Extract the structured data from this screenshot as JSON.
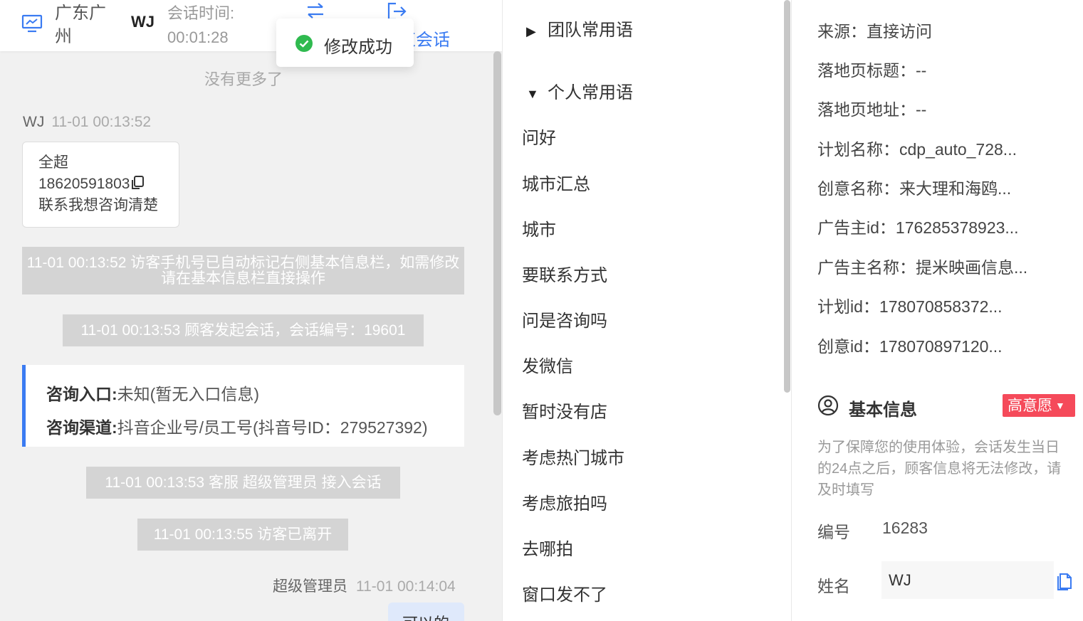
{
  "chat_header": {
    "location": "广东广州",
    "visitor_name": "WJ",
    "time_label": "会话时间:",
    "time_value": "00:01:28",
    "end_session_label": "束会话"
  },
  "toast": {
    "text": "修改成功"
  },
  "chat": {
    "no_more": "没有更多了",
    "visitor_message": {
      "sender": "WJ",
      "time": "11-01 00:13:52",
      "line1": "全超",
      "phone": "18620591803",
      "line3": "联系我想咨询清楚"
    },
    "system_messages": [
      "11-01 00:13:52 访客手机号已自动标记右侧基本信息栏，如需修改请在基本信息栏直接操作",
      "11-01 00:13:53 顾客发起会话，会话编号：19601",
      "11-01 00:13:53 客服 超级管理员 接入会话",
      "11-01 00:13:55 访客已离开"
    ],
    "entry_card": {
      "entry_label": "咨询入口:",
      "entry_value": "未知(暂无入口信息)",
      "channel_label": "咨询渠道:",
      "channel_value": "抖音企业号/员工号(抖音号ID：279527392)"
    },
    "agent_message": {
      "sender": "超级管理员",
      "time": "11-01 00:14:04",
      "text": "可以的"
    }
  },
  "phrases": {
    "team_group": "团队常用语",
    "personal_group": "个人常用语",
    "items": [
      "问好",
      "城市汇总",
      "城市",
      "要联系方式",
      "问是咨询吗",
      "发微信",
      "暂时没有店",
      "考虑热门城市",
      "考虑旅拍吗",
      "去哪拍",
      "窗口发不了"
    ]
  },
  "info": {
    "rows": [
      "来源：直接访问",
      "落地页标题：--",
      "落地页地址：--",
      "计划名称：cdp_auto_728...",
      "创意名称：来大理和海鸥...",
      "广告主id：176285378923...",
      "广告主名称：提米映画信息...",
      "计划id：178070858372...",
      "创意id：178070897120..."
    ],
    "basic_title": "基本信息",
    "intent_badge": "高意愿",
    "notice": "为了保障您的使用体验，会话发生当日的24点之后，顾客信息将无法修改，请及时填写",
    "number_label": "编号",
    "number_value": "16283",
    "name_label": "姓名",
    "name_value": "WJ"
  },
  "colors": {
    "accent_blue": "#3a7bf2",
    "success_green": "#2fba4f",
    "intent_red": "#f54a5a",
    "system_bubble": "#d4d4d4"
  },
  "icons": {
    "pc": "monitor-icon",
    "switch": "transfer-icon",
    "leave": "logout-icon",
    "toast": "check-circle-icon",
    "copy": "copy-icon",
    "user": "user-circle-icon",
    "edit": "document-edit-icon"
  }
}
